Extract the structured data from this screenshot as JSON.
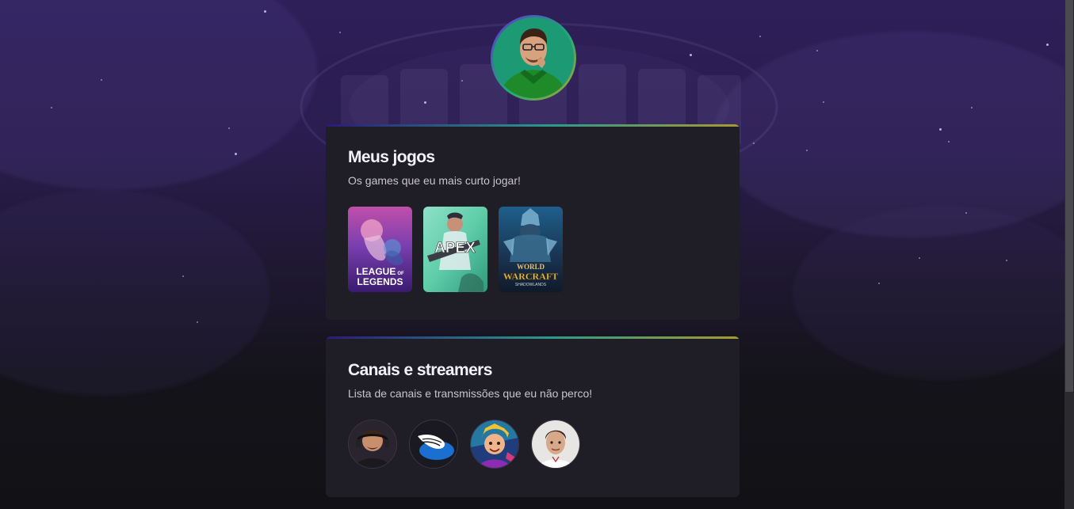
{
  "profile": {
    "avatar_icon": "profile-photo"
  },
  "games_section": {
    "title": "Meus jogos",
    "subtitle": "Os games que eu mais curto jogar!",
    "games": [
      {
        "name": "League of Legends",
        "cover_line1": "LEAGUE",
        "cover_line1b": "OF",
        "cover_line2": "LEGENDS"
      },
      {
        "name": "Apex Legends",
        "cover_text": "APEX"
      },
      {
        "name": "World of Warcraft Shadowlands",
        "cover_line1": "WORLD",
        "cover_line2": "WARCRAFT",
        "cover_line3": "SHADOWLANDS"
      }
    ]
  },
  "channels_section": {
    "title": "Canais e streamers",
    "subtitle": "Lista de canais e transmissões que eu não perco!",
    "channels": [
      {
        "icon": "streamer-avatar-1"
      },
      {
        "icon": "winged-logo"
      },
      {
        "icon": "streamer-avatar-3"
      },
      {
        "icon": "streamer-avatar-4"
      }
    ]
  },
  "colors": {
    "card_bg": "#1f1d26",
    "accent_gradient_start": "#2a1a7a",
    "accent_gradient_mid": "#2b9c8a",
    "accent_gradient_end": "#a89a2e",
    "avatar_bg": "#1c9a73"
  }
}
